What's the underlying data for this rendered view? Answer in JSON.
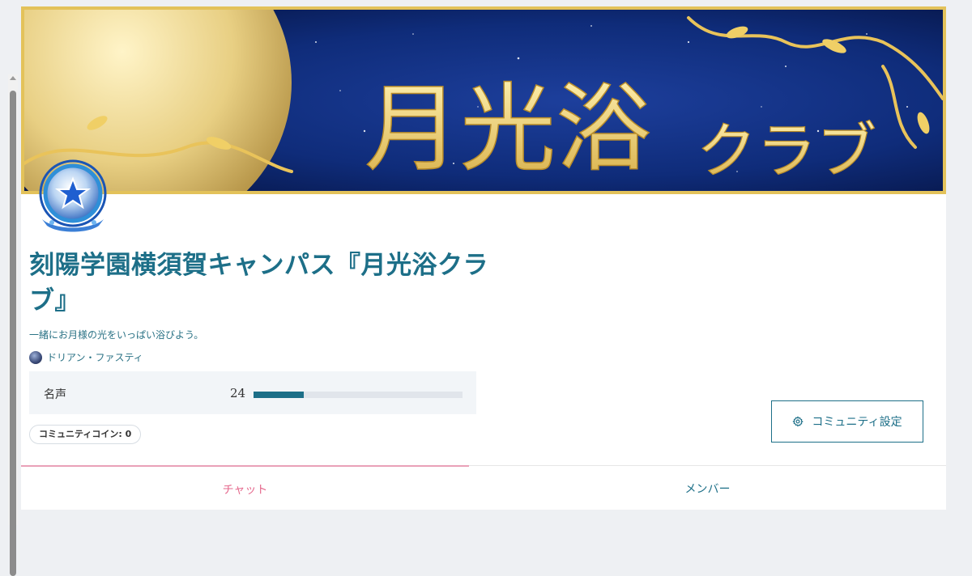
{
  "banner": {
    "title_kanji": "月光浴",
    "title_kana": "クラブ"
  },
  "community": {
    "title": "刻陽学園横須賀キャンパス『月光浴クラブ』",
    "description": "一緒にお月様の光をいっぱい浴びよう。",
    "owner": "ドリアン・ファスティ"
  },
  "fame": {
    "label": "名声",
    "value": "24",
    "progress": 0.24
  },
  "coins": {
    "label": "コミュニティコイン: 0"
  },
  "settings": {
    "label": "コミュニティ設定",
    "icon": "gear-icon"
  },
  "tabs": [
    {
      "label": "チャット",
      "active": true
    },
    {
      "label": "メンバー",
      "active": false
    }
  ],
  "colors": {
    "accent": "#1d6f88",
    "active_tab": "#e56a8e",
    "gold": "#e3c25a",
    "night_blue": "#0f2c7a"
  }
}
